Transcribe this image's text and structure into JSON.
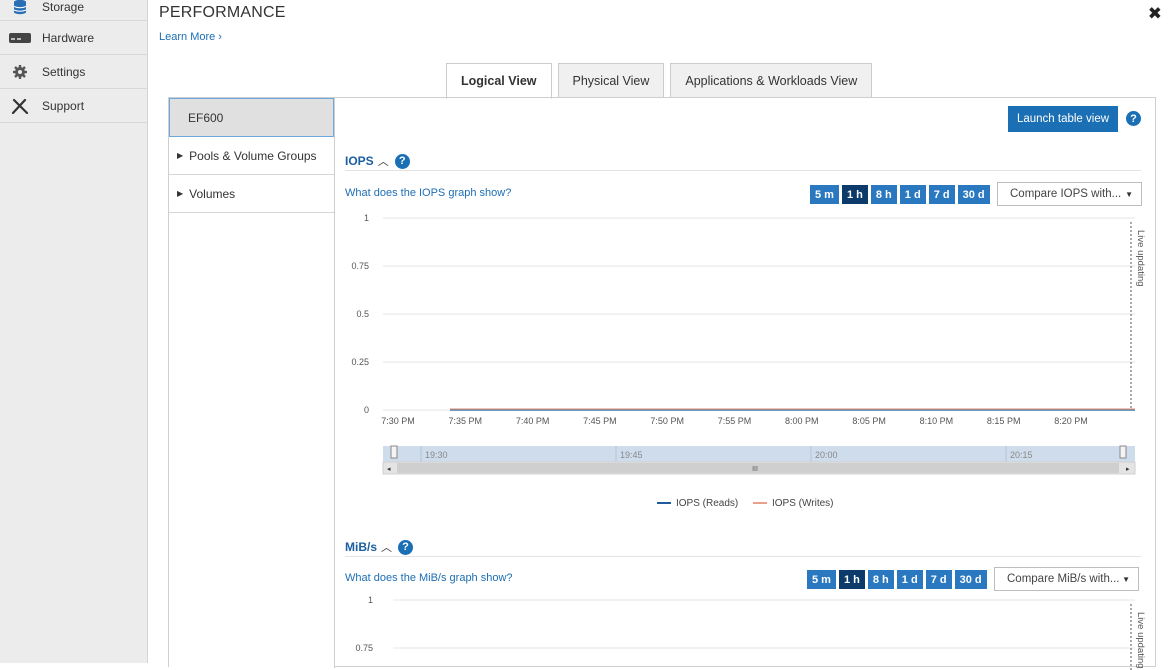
{
  "sidebar": {
    "items": [
      {
        "label": "Storage",
        "icon": "database-icon"
      },
      {
        "label": "Hardware",
        "icon": "hardware-icon"
      },
      {
        "label": "Settings",
        "icon": "gear-icon"
      },
      {
        "label": "Support",
        "icon": "tools-icon"
      }
    ]
  },
  "header": {
    "title": "PERFORMANCE",
    "learn_more": "Learn More ›",
    "close": "✖"
  },
  "tabs": [
    {
      "label": "Logical View",
      "active": true
    },
    {
      "label": "Physical View",
      "active": false
    },
    {
      "label": "Applications & Workloads View",
      "active": false
    }
  ],
  "nav": {
    "selected": "EF600",
    "items": [
      {
        "label": "Pools & Volume Groups"
      },
      {
        "label": "Volumes"
      }
    ]
  },
  "launch_table_view": "Launch table view",
  "iops": {
    "heading": "IOPS",
    "what": "What does the IOPS graph show?",
    "compare": "Compare IOPS with...",
    "live": "Live updating",
    "nav_labels": [
      "19:30",
      "19:45",
      "20:00",
      "20:15"
    ]
  },
  "mibs": {
    "heading": "MiB/s",
    "what": "What does the MiB/s graph show?",
    "compare": "Compare MiB/s with...",
    "live": "Live updating"
  },
  "time_ranges": [
    {
      "label": "5 m",
      "selected": false
    },
    {
      "label": "1 h",
      "selected": true
    },
    {
      "label": "8 h",
      "selected": false
    },
    {
      "label": "1 d",
      "selected": false
    },
    {
      "label": "7 d",
      "selected": false
    },
    {
      "label": "30 d",
      "selected": false
    }
  ],
  "colors": {
    "reads": "#1f5c99",
    "writes": "#e8a08a",
    "accent": "#1b6fb5"
  },
  "chart_data": [
    {
      "type": "line",
      "x": [
        "7:30 PM",
        "7:35 PM",
        "7:40 PM",
        "7:45 PM",
        "7:50 PM",
        "7:55 PM",
        "8:00 PM",
        "8:05 PM",
        "8:10 PM",
        "8:15 PM",
        "8:20 PM"
      ],
      "series": [
        {
          "name": "IOPS (Reads)",
          "values": [
            0,
            0,
            0,
            0,
            0,
            0,
            0,
            0,
            0,
            0,
            0
          ]
        },
        {
          "name": "IOPS (Writes)",
          "values": [
            0,
            0,
            0,
            0,
            0,
            0,
            0,
            0,
            0,
            0,
            0
          ]
        }
      ],
      "yticks": [
        "1",
        "0.75",
        "0.5",
        "0.25",
        "0"
      ],
      "ylim": [
        0,
        1
      ],
      "grid": true,
      "legend": "bottom"
    },
    {
      "type": "line",
      "yticks": [
        "1",
        "0.75"
      ],
      "ylim": [
        0,
        1
      ],
      "grid": true
    }
  ]
}
